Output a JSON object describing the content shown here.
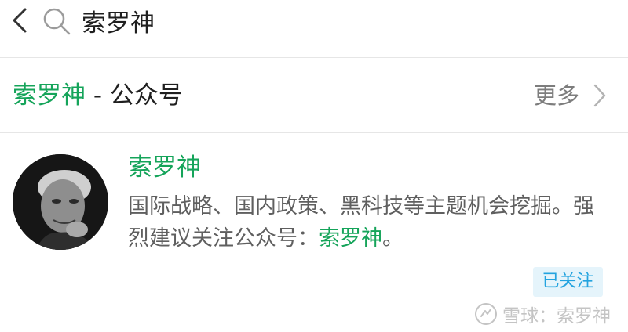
{
  "search": {
    "query": "索罗神"
  },
  "section": {
    "title_keyword": "索罗神",
    "separator": " - ",
    "title_suffix": "公众号",
    "more_label": "更多"
  },
  "account": {
    "name": "索罗神",
    "description_part1": "国际战略、国内政策、黑科技等主题机会挖掘。强烈建议关注公众号：",
    "description_highlight": "索罗神",
    "description_end": "。",
    "follow_status": "已关注"
  },
  "watermark": {
    "text": "雪球：索罗神"
  },
  "colors": {
    "accent_green": "#15a45a",
    "badge_bg": "#e5f4fb",
    "badge_text": "#23a3df"
  }
}
